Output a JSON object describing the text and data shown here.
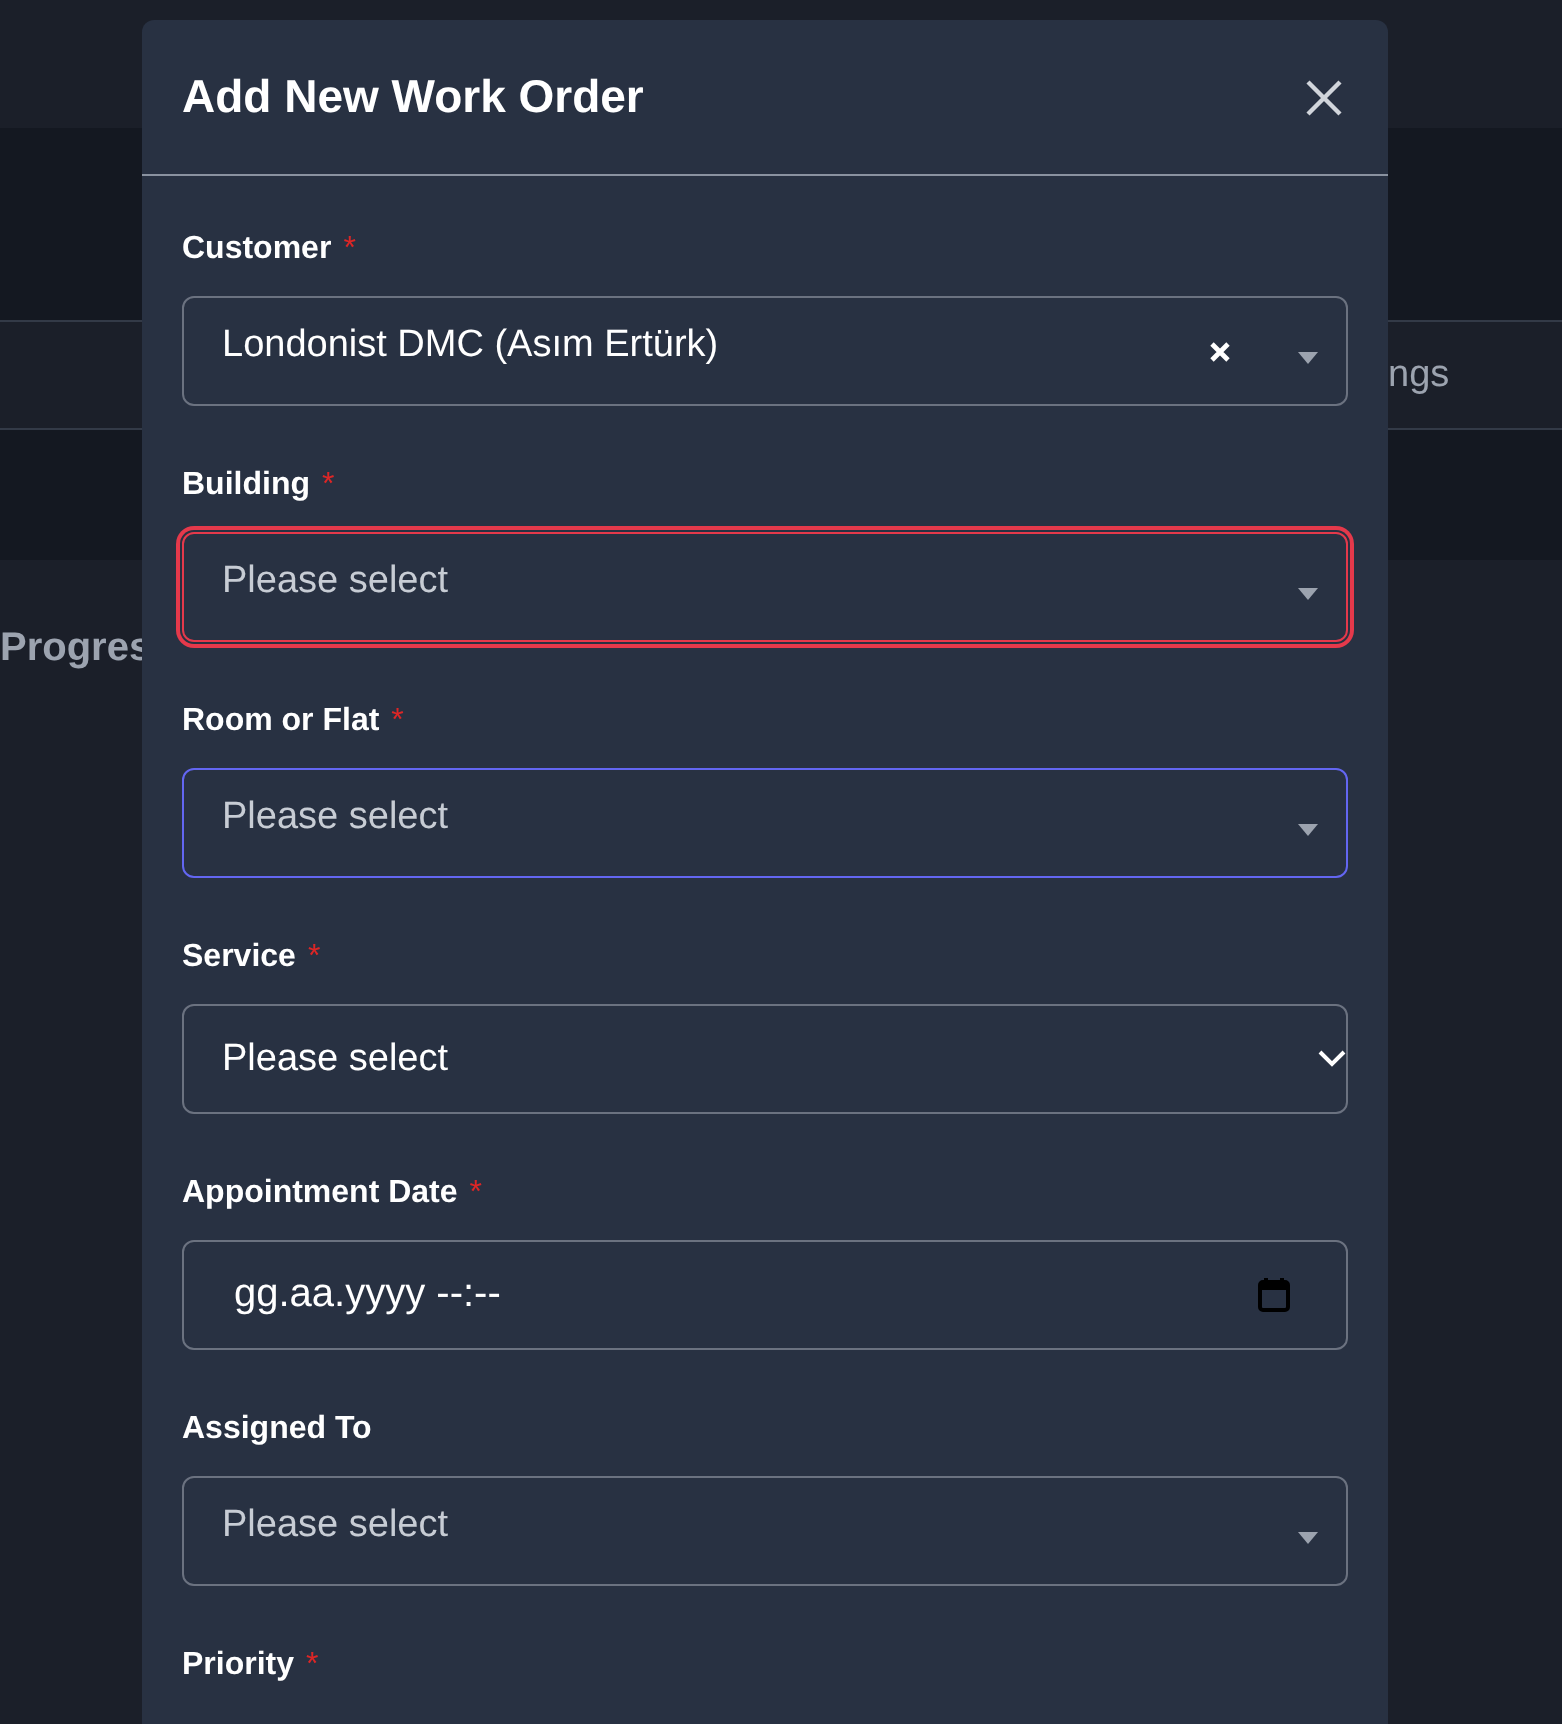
{
  "background": {
    "tab_fragment": "ngs",
    "heading_fragment": "Progres"
  },
  "modal": {
    "title": "Add New Work Order",
    "fields": [
      {
        "label": "Customer",
        "required_mark": "*",
        "kind": "combo",
        "value": "Londonist DMC (Asım Ertürk)",
        "clearable": true,
        "invalid": false,
        "focused": false
      },
      {
        "label": "Building",
        "required_mark": "*",
        "kind": "combo",
        "placeholder": "Please select",
        "invalid": true,
        "focused": false
      },
      {
        "label": "Room or Flat",
        "required_mark": "*",
        "kind": "combo",
        "placeholder": "Please select",
        "invalid": false,
        "focused": true
      },
      {
        "label": "Service",
        "required_mark": "*",
        "kind": "select",
        "value": "Please select",
        "invalid": false,
        "focused": false
      },
      {
        "label": "Appointment Date",
        "required_mark": "*",
        "kind": "datetime",
        "value": "gg.aa.yyyy --:--",
        "invalid": false,
        "focused": false
      },
      {
        "label": "Assigned To",
        "kind": "combo",
        "placeholder": "Please select",
        "invalid": false,
        "focused": false
      },
      {
        "label": "Priority",
        "required_mark": "*",
        "kind": "label_only"
      }
    ]
  }
}
